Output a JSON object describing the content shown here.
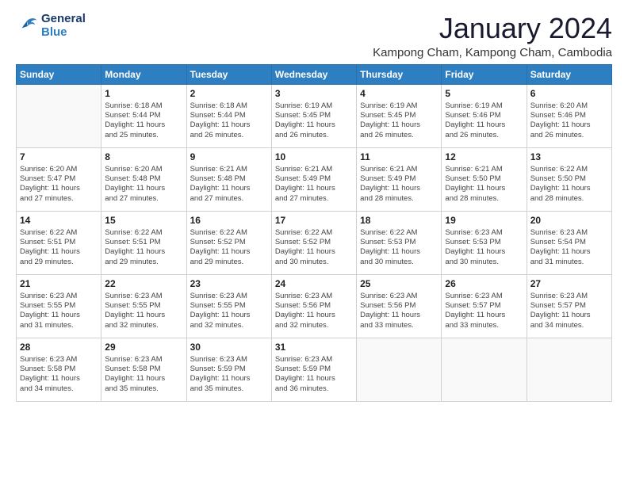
{
  "logo": {
    "line1": "General",
    "line2": "Blue"
  },
  "title": "January 2024",
  "subtitle": "Kampong Cham, Kampong Cham, Cambodia",
  "weekdays": [
    "Sunday",
    "Monday",
    "Tuesday",
    "Wednesday",
    "Thursday",
    "Friday",
    "Saturday"
  ],
  "weeks": [
    [
      {
        "day": "",
        "info": ""
      },
      {
        "day": "1",
        "info": "Sunrise: 6:18 AM\nSunset: 5:44 PM\nDaylight: 11 hours\nand 25 minutes."
      },
      {
        "day": "2",
        "info": "Sunrise: 6:18 AM\nSunset: 5:44 PM\nDaylight: 11 hours\nand 26 minutes."
      },
      {
        "day": "3",
        "info": "Sunrise: 6:19 AM\nSunset: 5:45 PM\nDaylight: 11 hours\nand 26 minutes."
      },
      {
        "day": "4",
        "info": "Sunrise: 6:19 AM\nSunset: 5:45 PM\nDaylight: 11 hours\nand 26 minutes."
      },
      {
        "day": "5",
        "info": "Sunrise: 6:19 AM\nSunset: 5:46 PM\nDaylight: 11 hours\nand 26 minutes."
      },
      {
        "day": "6",
        "info": "Sunrise: 6:20 AM\nSunset: 5:46 PM\nDaylight: 11 hours\nand 26 minutes."
      }
    ],
    [
      {
        "day": "7",
        "info": "Sunrise: 6:20 AM\nSunset: 5:47 PM\nDaylight: 11 hours\nand 27 minutes."
      },
      {
        "day": "8",
        "info": "Sunrise: 6:20 AM\nSunset: 5:48 PM\nDaylight: 11 hours\nand 27 minutes."
      },
      {
        "day": "9",
        "info": "Sunrise: 6:21 AM\nSunset: 5:48 PM\nDaylight: 11 hours\nand 27 minutes."
      },
      {
        "day": "10",
        "info": "Sunrise: 6:21 AM\nSunset: 5:49 PM\nDaylight: 11 hours\nand 27 minutes."
      },
      {
        "day": "11",
        "info": "Sunrise: 6:21 AM\nSunset: 5:49 PM\nDaylight: 11 hours\nand 28 minutes."
      },
      {
        "day": "12",
        "info": "Sunrise: 6:21 AM\nSunset: 5:50 PM\nDaylight: 11 hours\nand 28 minutes."
      },
      {
        "day": "13",
        "info": "Sunrise: 6:22 AM\nSunset: 5:50 PM\nDaylight: 11 hours\nand 28 minutes."
      }
    ],
    [
      {
        "day": "14",
        "info": "Sunrise: 6:22 AM\nSunset: 5:51 PM\nDaylight: 11 hours\nand 29 minutes."
      },
      {
        "day": "15",
        "info": "Sunrise: 6:22 AM\nSunset: 5:51 PM\nDaylight: 11 hours\nand 29 minutes."
      },
      {
        "day": "16",
        "info": "Sunrise: 6:22 AM\nSunset: 5:52 PM\nDaylight: 11 hours\nand 29 minutes."
      },
      {
        "day": "17",
        "info": "Sunrise: 6:22 AM\nSunset: 5:52 PM\nDaylight: 11 hours\nand 30 minutes."
      },
      {
        "day": "18",
        "info": "Sunrise: 6:22 AM\nSunset: 5:53 PM\nDaylight: 11 hours\nand 30 minutes."
      },
      {
        "day": "19",
        "info": "Sunrise: 6:23 AM\nSunset: 5:53 PM\nDaylight: 11 hours\nand 30 minutes."
      },
      {
        "day": "20",
        "info": "Sunrise: 6:23 AM\nSunset: 5:54 PM\nDaylight: 11 hours\nand 31 minutes."
      }
    ],
    [
      {
        "day": "21",
        "info": "Sunrise: 6:23 AM\nSunset: 5:55 PM\nDaylight: 11 hours\nand 31 minutes."
      },
      {
        "day": "22",
        "info": "Sunrise: 6:23 AM\nSunset: 5:55 PM\nDaylight: 11 hours\nand 32 minutes."
      },
      {
        "day": "23",
        "info": "Sunrise: 6:23 AM\nSunset: 5:55 PM\nDaylight: 11 hours\nand 32 minutes."
      },
      {
        "day": "24",
        "info": "Sunrise: 6:23 AM\nSunset: 5:56 PM\nDaylight: 11 hours\nand 32 minutes."
      },
      {
        "day": "25",
        "info": "Sunrise: 6:23 AM\nSunset: 5:56 PM\nDaylight: 11 hours\nand 33 minutes."
      },
      {
        "day": "26",
        "info": "Sunrise: 6:23 AM\nSunset: 5:57 PM\nDaylight: 11 hours\nand 33 minutes."
      },
      {
        "day": "27",
        "info": "Sunrise: 6:23 AM\nSunset: 5:57 PM\nDaylight: 11 hours\nand 34 minutes."
      }
    ],
    [
      {
        "day": "28",
        "info": "Sunrise: 6:23 AM\nSunset: 5:58 PM\nDaylight: 11 hours\nand 34 minutes."
      },
      {
        "day": "29",
        "info": "Sunrise: 6:23 AM\nSunset: 5:58 PM\nDaylight: 11 hours\nand 35 minutes."
      },
      {
        "day": "30",
        "info": "Sunrise: 6:23 AM\nSunset: 5:59 PM\nDaylight: 11 hours\nand 35 minutes."
      },
      {
        "day": "31",
        "info": "Sunrise: 6:23 AM\nSunset: 5:59 PM\nDaylight: 11 hours\nand 36 minutes."
      },
      {
        "day": "",
        "info": ""
      },
      {
        "day": "",
        "info": ""
      },
      {
        "day": "",
        "info": ""
      }
    ]
  ]
}
